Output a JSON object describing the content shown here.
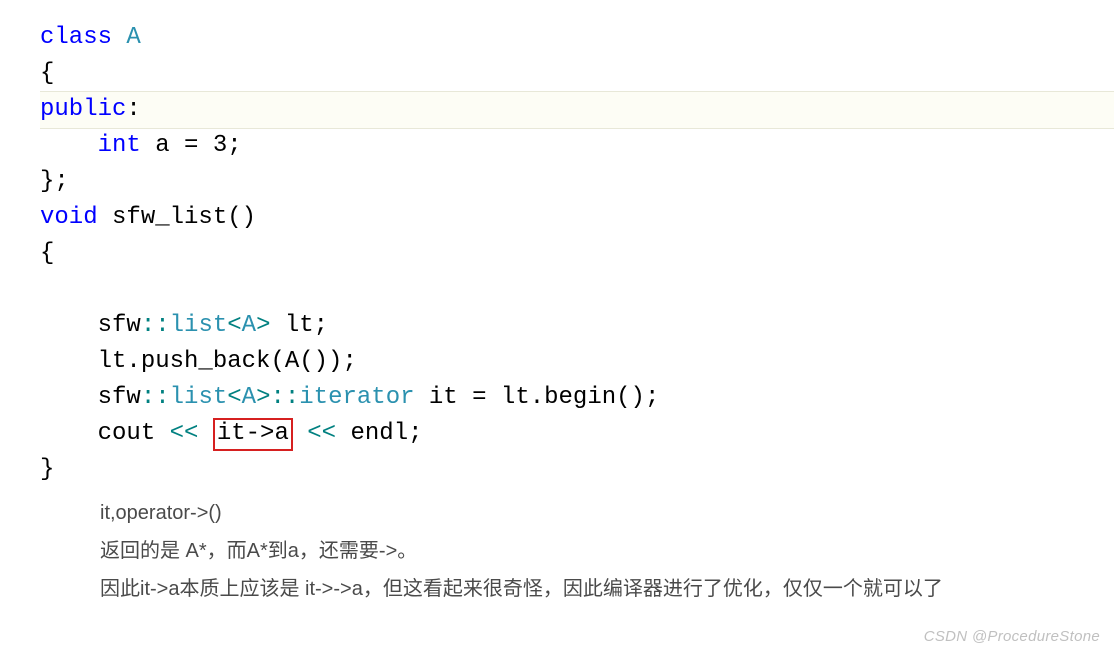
{
  "code": {
    "l1_class": "class",
    "l1_name": "A",
    "l2_brace": "{",
    "l3_public": "public",
    "l3_colon": ":",
    "l4_indent": "    ",
    "l4_int": "int",
    "l4_rest": " a = 3;",
    "l5_close": "};",
    "l6_void": "void",
    "l6_fn": " sfw_list()",
    "l7_brace": "{",
    "l8_indent": "    ",
    "l8_ns": "sfw",
    "l8_scope": "::",
    "l8_list": "list",
    "l8_lt": "<",
    "l8_A": "A",
    "l8_gt": ">",
    "l8_rest": " lt;",
    "l9_indent": "    ",
    "l9_rest": "lt.push_back(A());",
    "l10_indent": "    ",
    "l10_ns": "sfw",
    "l10_scope": "::",
    "l10_list": "list",
    "l10_lt": "<",
    "l10_A": "A",
    "l10_gt": ">",
    "l10_scope2": "::",
    "l10_iter": "iterator",
    "l10_rest": " it = lt.begin();",
    "l11_indent": "    ",
    "l11_cout": "cout ",
    "l11_shift1": "<<",
    "l11_sp1": " ",
    "l11_box": "it->a",
    "l11_sp2": " ",
    "l11_shift2": "<<",
    "l11_endl": " endl;",
    "l12_close": "}"
  },
  "explain": {
    "p1": "it,operator->()",
    "p2": "返回的是 A*，而A*到a，还需要->。",
    "p3": "因此it->a本质上应该是 it->->a，但这看起来很奇怪，因此编译器进行了优化，仅仅一个就可以了"
  },
  "watermark": "CSDN @ProcedureStone"
}
